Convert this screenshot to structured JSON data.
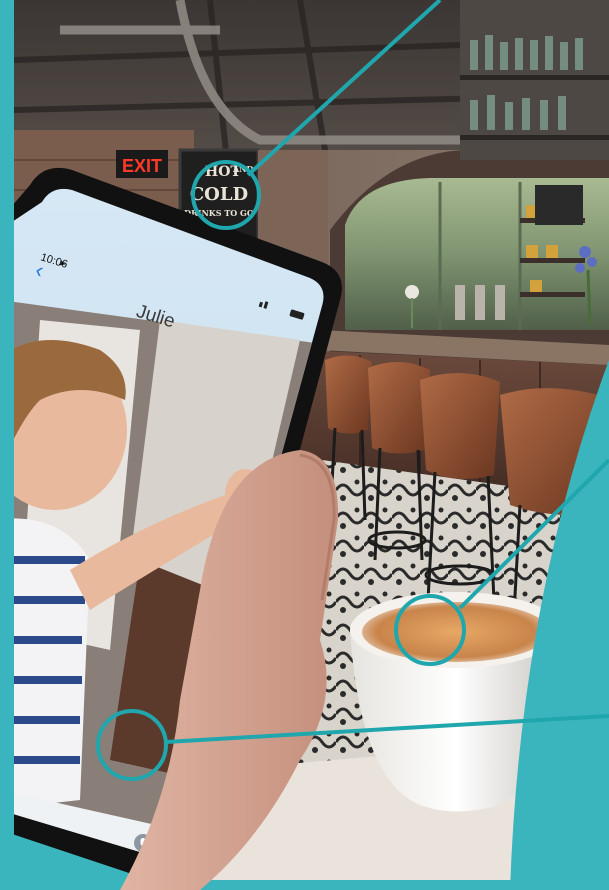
{
  "scene": {
    "exit_sign": "EXIT",
    "chalk_sign": {
      "line1": "HOT",
      "line2": "AND",
      "line3": "COLD",
      "line4": "DRINKS TO GO"
    }
  },
  "phone": {
    "status_time": "10:06",
    "contact_name": "Julie",
    "back_icon": "chevron-left-icon",
    "mic_icon": "microphone-icon"
  },
  "colors": {
    "teal_accent": "#1fa7ad",
    "frame_teal": "#3bb5bd"
  }
}
